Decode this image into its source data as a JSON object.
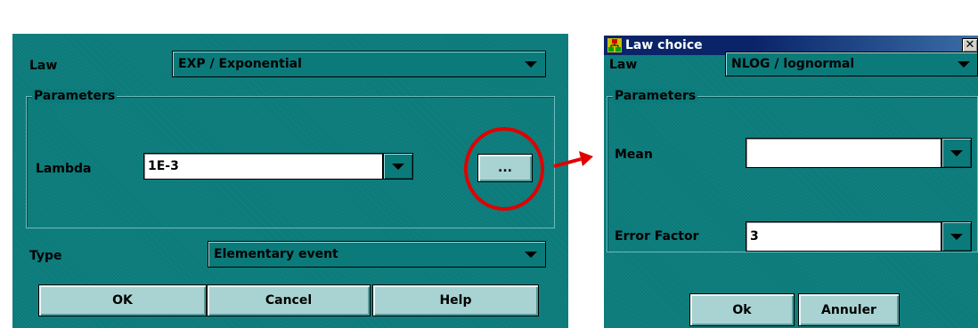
{
  "left_dialog": {
    "law_label": "Law",
    "law_value": "EXP / Exponential",
    "parameters_title": "Parameters",
    "lambda_label": "Lambda",
    "lambda_value": "1E-3",
    "ellipsis_label": "...",
    "type_label": "Type",
    "type_value": "Elementary event",
    "ok_label": "OK",
    "cancel_label": "Cancel",
    "help_label": "Help"
  },
  "right_dialog": {
    "title": "Law choice",
    "close_glyph": "✕",
    "law_label": "Law",
    "law_value": "NLOG / lognormal",
    "parameters_title": "Parameters",
    "mean_label": "Mean",
    "mean_value": "",
    "error_factor_label": "Error Factor",
    "error_factor_value": "3",
    "ok_label": "Ok",
    "cancel_label": "Annuler"
  },
  "annotation": {
    "highlight_color": "#e00000",
    "icons": [
      "red-circle-highlight",
      "red-arrow-icon"
    ]
  },
  "colors": {
    "panel": "#0b7a7a",
    "button": "#a9d3d3",
    "titlebar": "#0a246a"
  }
}
